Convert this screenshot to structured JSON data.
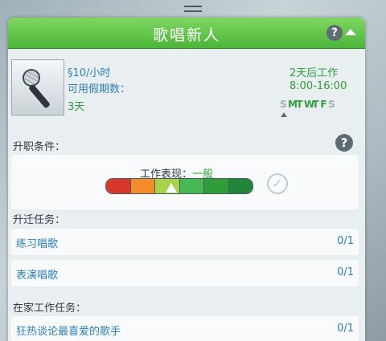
{
  "header": {
    "title": "歌唱新人",
    "help_icon": "?"
  },
  "job": {
    "wage": "§10/小时",
    "vacation_label": "可用假期数：",
    "vacation_days": "3天",
    "next_work": "2天后工作",
    "hours": "8:00-16:00",
    "days": [
      {
        "letter": "S",
        "active": false
      },
      {
        "letter": "M",
        "active": true
      },
      {
        "letter": "T",
        "active": true
      },
      {
        "letter": "W",
        "active": true
      },
      {
        "letter": "T",
        "active": true
      },
      {
        "letter": "F",
        "active": true
      },
      {
        "letter": "S",
        "active": false
      }
    ],
    "current_day_index": 0
  },
  "promotion": {
    "label": "升职条件：",
    "help_icon": "?",
    "performance_label": "工作表现：",
    "performance_value": "一般",
    "performance_level": 0.45,
    "bar_colors": [
      "#d9362c",
      "#f08c2a",
      "#a8d24a",
      "#48b856",
      "#2e9d3a",
      "#23853a"
    ]
  },
  "promotion_tasks": {
    "label": "升迁任务：",
    "items": [
      {
        "name": "练习唱歌",
        "progress": "0/1"
      },
      {
        "name": "表演唱歌",
        "progress": "0/1"
      }
    ]
  },
  "home_tasks": {
    "label": "在家工作任务：",
    "items": [
      {
        "name": "狂热谈论最喜爱的歌手",
        "progress": "0/1"
      }
    ]
  },
  "colors": {
    "header_green": "#4cb43a",
    "link_blue": "#2e7fb8",
    "text_green": "#2e9d3a"
  }
}
